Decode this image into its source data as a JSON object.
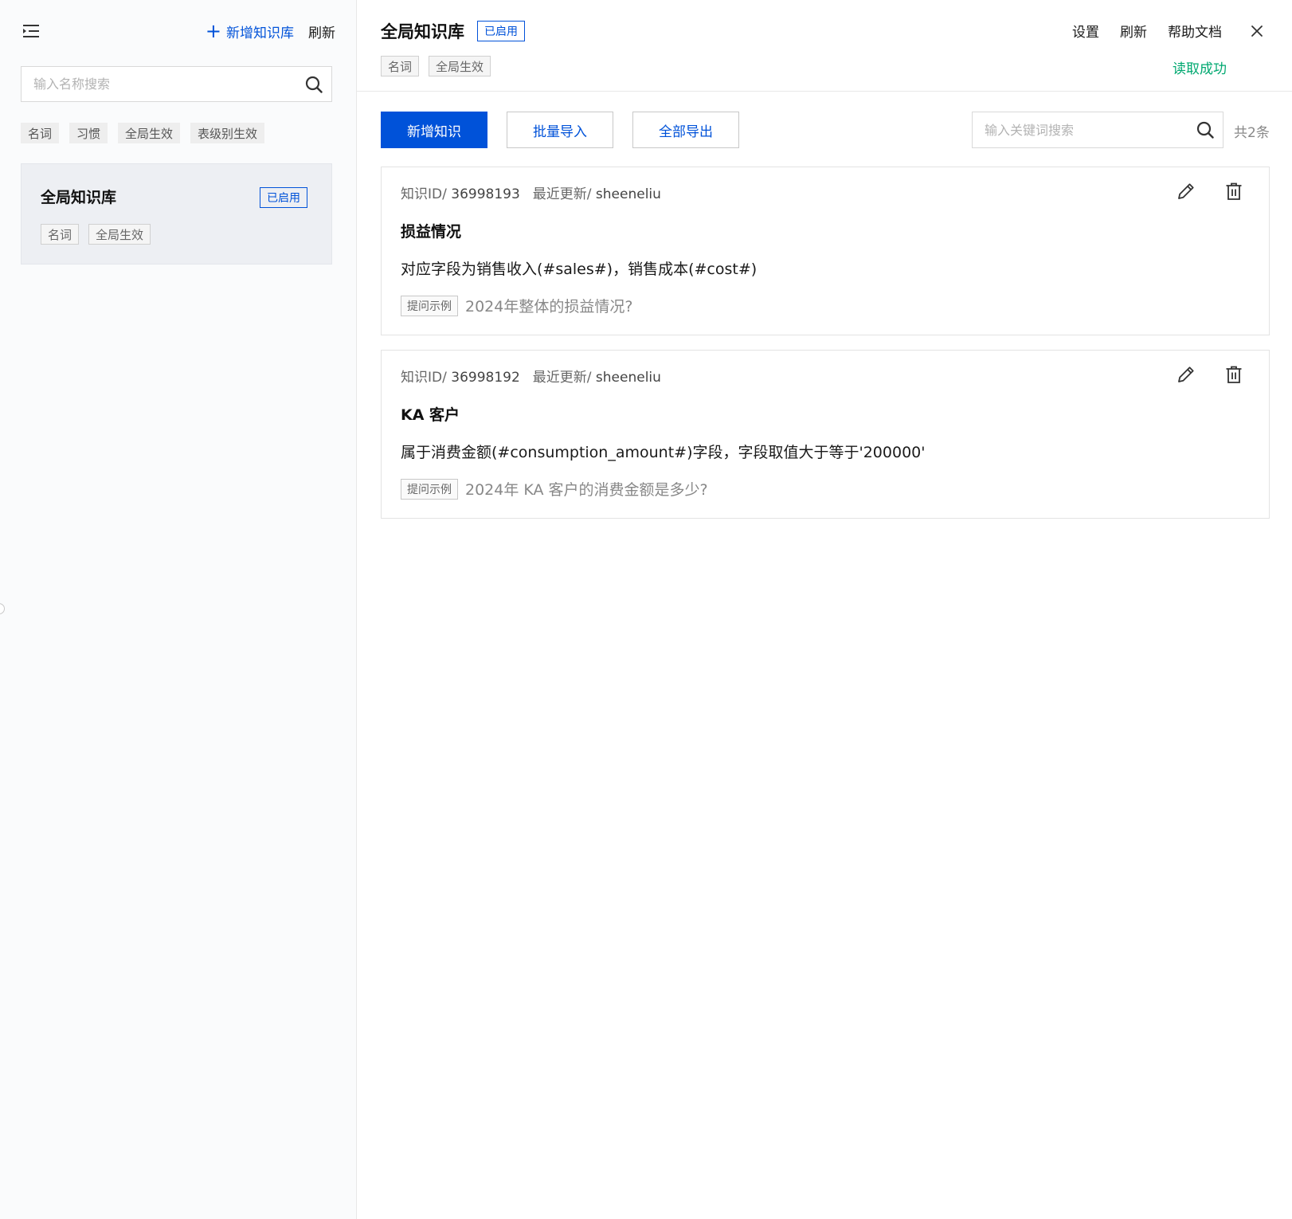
{
  "left": {
    "add_kb_label": "新增知识库",
    "refresh_label": "刷新",
    "search_placeholder": "输入名称搜索",
    "filter_tags": [
      "名词",
      "习惯",
      "全局生效",
      "表级别生效"
    ],
    "kb_list": [
      {
        "name": "全局知识库",
        "status": "已启用",
        "tags": [
          "名词",
          "全局生效"
        ]
      }
    ]
  },
  "header": {
    "title": "全局知识库",
    "status": "已启用",
    "tags": [
      "名词",
      "全局生效"
    ],
    "actions": [
      "设置",
      "刷新",
      "帮助文档"
    ],
    "read_status": "读取成功"
  },
  "toolbar": {
    "add_label": "新增知识",
    "import_label": "批量导入",
    "export_label": "全部导出",
    "search_placeholder": "输入关键词搜索",
    "total": "共2条"
  },
  "knowledge": [
    {
      "id_label": "知识ID/",
      "id": "36998193",
      "updated_label": "最近更新/",
      "updated_by": "sheeneliu",
      "title": "损益情况",
      "desc": "对应字段为销售收入(#sales#)，销售成本(#cost#)",
      "example_tag": "提问示例",
      "example": "2024年整体的损益情况?"
    },
    {
      "id_label": "知识ID/",
      "id": "36998192",
      "updated_label": "最近更新/",
      "updated_by": "sheeneliu",
      "title": "KA 客户",
      "desc": "属于消费金额(#consumption_amount#)字段，字段取值大于等于'200000'",
      "example_tag": "提问示例",
      "example": "2024年 KA 客户的消费金额是多少?"
    }
  ],
  "colors": {
    "primary": "#0052d9",
    "success": "#00a870"
  }
}
